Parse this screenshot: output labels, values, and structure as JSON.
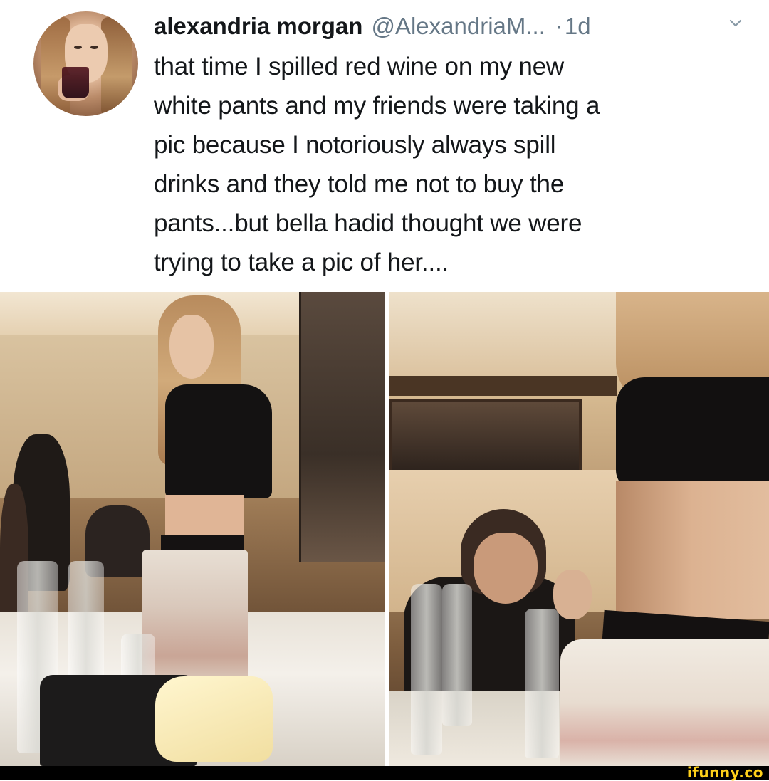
{
  "tweet": {
    "display_name": "alexandria morgan",
    "handle": "@AlexandriaM...",
    "separator": "·",
    "time_ago": "1d",
    "text": "that time I spilled red wine on my new\nwhite pants and my friends were taking a\npic because I notoriously always spill\ndrinks and they told me not to buy the\npants...but bella hadid thought we were\ntrying to take a pic of her....",
    "caret_icon": "chevron-down-icon",
    "colors": {
      "name": "#14171a",
      "meta": "#657786",
      "text": "#14171a"
    }
  },
  "photos": [
    {
      "name": "photo-left"
    },
    {
      "name": "photo-right"
    }
  ],
  "footer": {
    "watermark": "ifunny.co",
    "watermark_color": "#ffd11a",
    "bar_color": "#000000"
  }
}
